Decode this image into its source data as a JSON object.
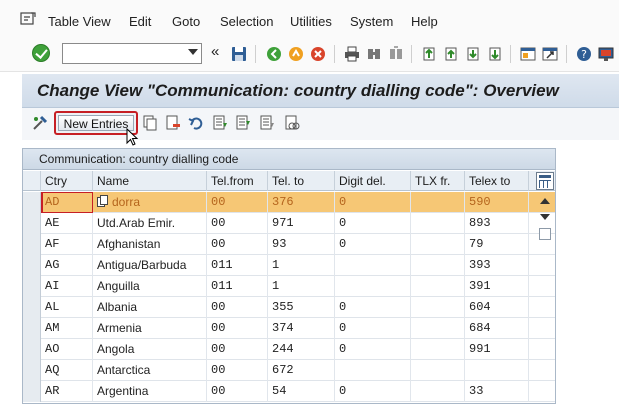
{
  "menu": {
    "items": [
      {
        "label": "Table View"
      },
      {
        "label": "Edit"
      },
      {
        "label": "Goto"
      },
      {
        "label": "Selection"
      },
      {
        "label": "Utilities"
      },
      {
        "label": "System"
      },
      {
        "label": "Help"
      }
    ]
  },
  "toolbar": {
    "command_value": "",
    "icons": [
      "enter-check-icon",
      "back-arrow-icon",
      "save-icon",
      "back-icon",
      "exit-icon",
      "cancel-icon",
      "print-icon",
      "find-icon",
      "find-next-icon",
      "first-page-icon",
      "previous-page-icon",
      "next-page-icon",
      "last-page-icon",
      "create-session-icon",
      "shortcut-icon",
      "help-icon",
      "customize-layout-icon"
    ]
  },
  "title": {
    "text": "Change View \"Communication: country dialling code\": Overview"
  },
  "app_toolbar": {
    "new_entries_label": "New Entries"
  },
  "table": {
    "caption": "Communication: country dialling code",
    "columns": [
      "Ctry",
      "Name",
      "Tel.from",
      "Tel. to",
      "Digit del.",
      "TLX fr.",
      "Telex to"
    ],
    "rows": [
      {
        "ctry": "AD",
        "name": "dorra",
        "tel_from": "00",
        "tel_to": "376",
        "digit_del": "0",
        "tlx_fr": "",
        "telex_to": "590",
        "selected": true
      },
      {
        "ctry": "AE",
        "name": "Utd.Arab Emir.",
        "tel_from": "00",
        "tel_to": "971",
        "digit_del": "0",
        "tlx_fr": "",
        "telex_to": "893"
      },
      {
        "ctry": "AF",
        "name": "Afghanistan",
        "tel_from": "00",
        "tel_to": "93",
        "digit_del": "0",
        "tlx_fr": "",
        "telex_to": "79"
      },
      {
        "ctry": "AG",
        "name": "Antigua/Barbuda",
        "tel_from": "011",
        "tel_to": "1",
        "digit_del": "",
        "tlx_fr": "",
        "telex_to": "393"
      },
      {
        "ctry": "AI",
        "name": "Anguilla",
        "tel_from": "011",
        "tel_to": "1",
        "digit_del": "",
        "tlx_fr": "",
        "telex_to": "391"
      },
      {
        "ctry": "AL",
        "name": "Albania",
        "tel_from": "00",
        "tel_to": "355",
        "digit_del": "0",
        "tlx_fr": "",
        "telex_to": "604"
      },
      {
        "ctry": "AM",
        "name": "Armenia",
        "tel_from": "00",
        "tel_to": "374",
        "digit_del": "0",
        "tlx_fr": "",
        "telex_to": "684"
      },
      {
        "ctry": "AO",
        "name": "Angola",
        "tel_from": "00",
        "tel_to": "244",
        "digit_del": "0",
        "tlx_fr": "",
        "telex_to": "991"
      },
      {
        "ctry": "AQ",
        "name": "Antarctica",
        "tel_from": "00",
        "tel_to": "672",
        "digit_del": "",
        "tlx_fr": "",
        "telex_to": ""
      },
      {
        "ctry": "AR",
        "name": "Argentina",
        "tel_from": "00",
        "tel_to": "54",
        "digit_del": "0",
        "tlx_fr": "",
        "telex_to": "33"
      }
    ]
  },
  "colors": {
    "selected_row": "#f6c775",
    "highlight_border": "#c61f25",
    "title_bg": "#dfe7f1"
  }
}
